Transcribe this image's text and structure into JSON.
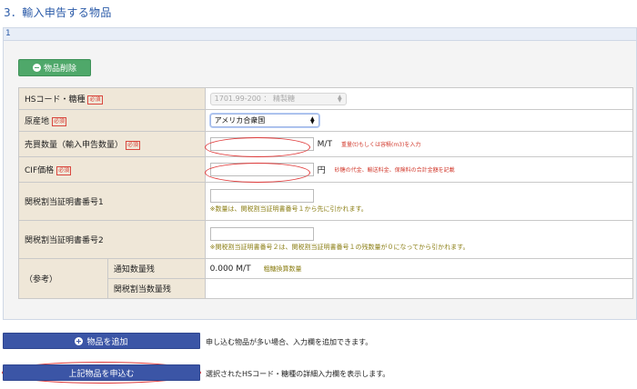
{
  "section_title": "3．輸入申告する物品",
  "panel_number": "1",
  "delete_button": "物品削除",
  "required_badge": "必須",
  "rows": {
    "hs_label": "HSコード・糖種",
    "hs_value": "1701.99-200 ： 精製糖",
    "origin_label": "原産地",
    "origin_value": "アメリカ合衆国",
    "quantity_label": "売買数量（輸入申告数量）",
    "quantity_value": "",
    "quantity_unit": "M/T",
    "quantity_note": "重量(t)もしくは容積(m3)を入力",
    "cif_label": "CIF価格",
    "cif_value": "",
    "cif_unit": "円",
    "cif_note": "砂糖の代金、輸送料金、保険料の合計金額を記載",
    "cert1_label": "関税割当証明書番号1",
    "cert1_note": "※数量は、関税割当証明書番号１から先に引かれます。",
    "cert2_label": "関税割当証明書番号2",
    "cert2_note": "※関税割当証明書番号２は、関税割当証明書番号１の残数量が０になってから引かれます。",
    "reference_label": "（参考）",
    "notified_label": "通知数量残",
    "notified_value": "0.000 M/T",
    "notified_note": "粗糖換算数量",
    "quota_remaining_label": "関税割当数量残",
    "quota_remaining_value": ""
  },
  "add_button": "物品を追加",
  "add_desc": "申し込む物品が多い場合、入力欄を追加できます。",
  "submit_button": "上記物品を申込む",
  "submit_desc": "選択されたHSコード・糖種の詳細入力欄を表示します。",
  "colors": {
    "accent_blue": "#3b55a6",
    "delete_green": "#4fa86a",
    "label_bg": "#efe7d8",
    "required_red": "#d9463d",
    "annotation_red": "#e03a3a",
    "note_olive": "#8a7d12"
  }
}
